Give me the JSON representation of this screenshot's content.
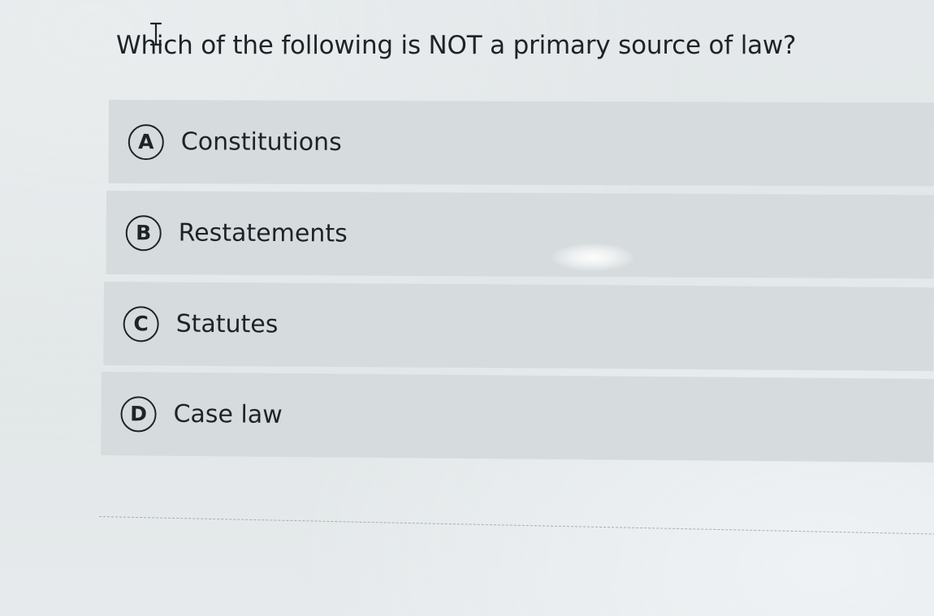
{
  "question": {
    "text": "Which of the following is NOT a primary source of law?"
  },
  "options": [
    {
      "letter": "A",
      "label": "Constitutions"
    },
    {
      "letter": "B",
      "label": "Restatements"
    },
    {
      "letter": "C",
      "label": "Statutes"
    },
    {
      "letter": "D",
      "label": "Case law"
    }
  ],
  "cursor": {
    "icon": "text-cursor-icon"
  }
}
